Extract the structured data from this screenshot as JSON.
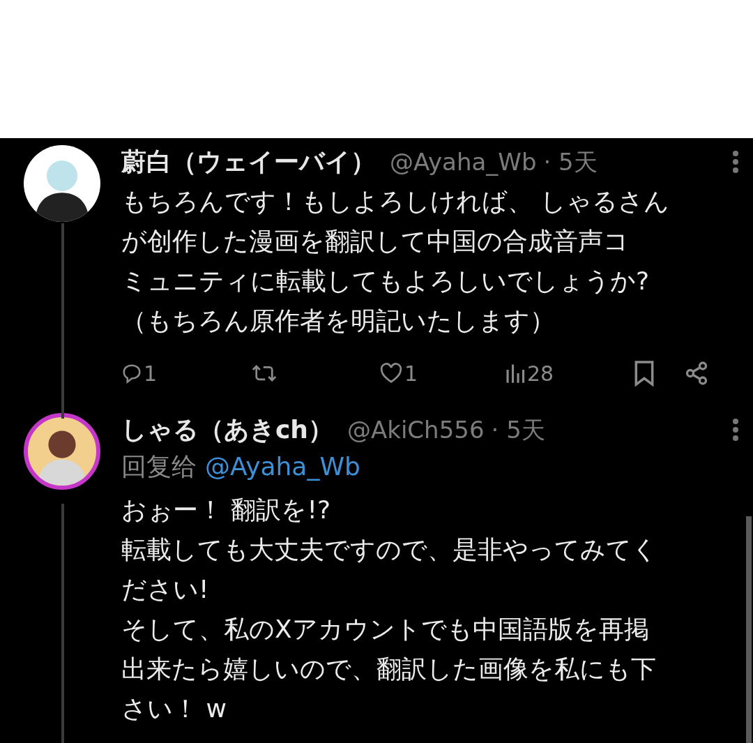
{
  "posts": [
    {
      "name": "蔚白（ウェイーバイ）",
      "handle": "@Ayaha_Wb",
      "time": "· 5天",
      "avatar_ring": false,
      "lines": [
        "もちろんです！もしよろしければ、 しゃるさん",
        "が创作した漫画を翻訳して中国の合成音声コ",
        "ミュニティに転載してもよろしいでしょうか?",
        "（もちろん原作者を明記いたします）"
      ],
      "actions": {
        "replies": "1",
        "likes": "1",
        "views": "28"
      }
    },
    {
      "name": "しゃる（あきch）",
      "handle": "@AkiCh556",
      "time": "· 5天",
      "avatar_ring": true,
      "reply_to": {
        "label": "回复给",
        "handle": "@Ayaha_Wb"
      },
      "lines": [
        "おぉー！ 翻訳を!?",
        "転載しても大丈夫ですので、是非やってみてく",
        "ださい!",
        "そして、私のXアカウントでも中国語版を再掲",
        "出来たら嬉しいので、翻訳した画像を私にも下",
        "さい！ w"
      ]
    }
  ]
}
